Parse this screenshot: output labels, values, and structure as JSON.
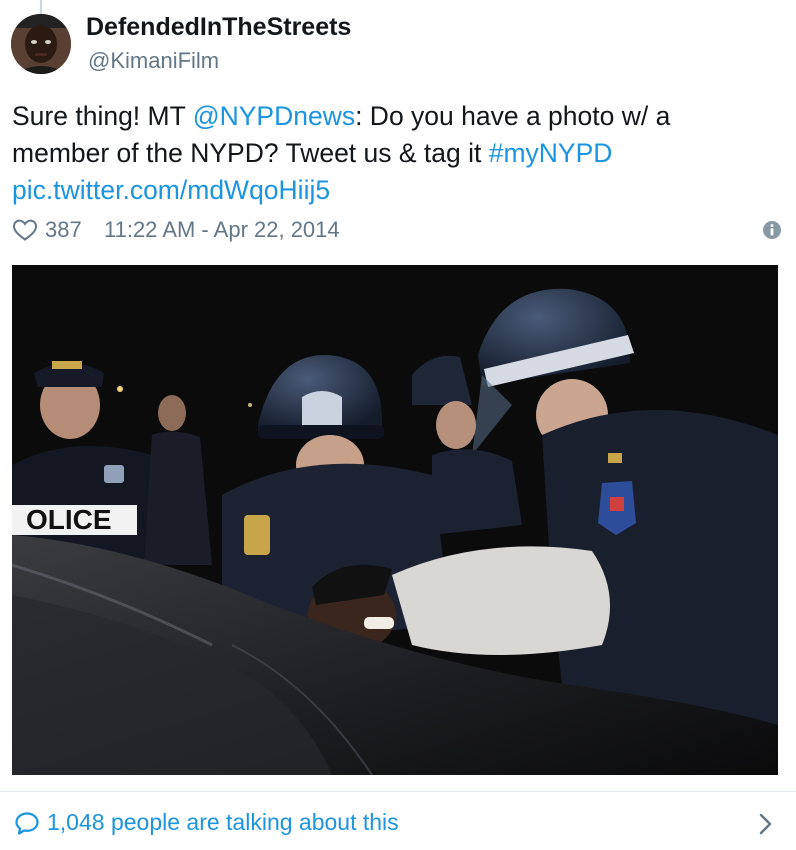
{
  "tweet": {
    "author": {
      "display_name": "DefendedInTheStreets",
      "handle": "@KimaniFilm",
      "avatar_icon": "user-avatar"
    },
    "text": {
      "part1": "Sure thing! MT ",
      "mention": "@NYPDnews",
      "part2": ": Do you have a photo w/ a member of the NYPD? Tweet us & tag it ",
      "hashtag": "#myNYPD",
      "pic_link": "pic.twitter.com/mdWqoHiij5"
    },
    "meta": {
      "like_count": "387",
      "timestamp": "11:22 AM - Apr 22, 2014",
      "like_icon": "heart-icon",
      "info_icon": "info-icon"
    },
    "media": {
      "patch_text": "OLICE",
      "description_icon": "photo"
    },
    "footer": {
      "talking_text": "1,048 people are talking about this",
      "bubble_icon": "speech-bubble-icon",
      "chevron_icon": "chevron-right-icon"
    },
    "colors": {
      "link": "#1b95e0",
      "secondary_text": "#657786",
      "primary_text": "#14171a",
      "divider": "#e1e8ed"
    }
  }
}
